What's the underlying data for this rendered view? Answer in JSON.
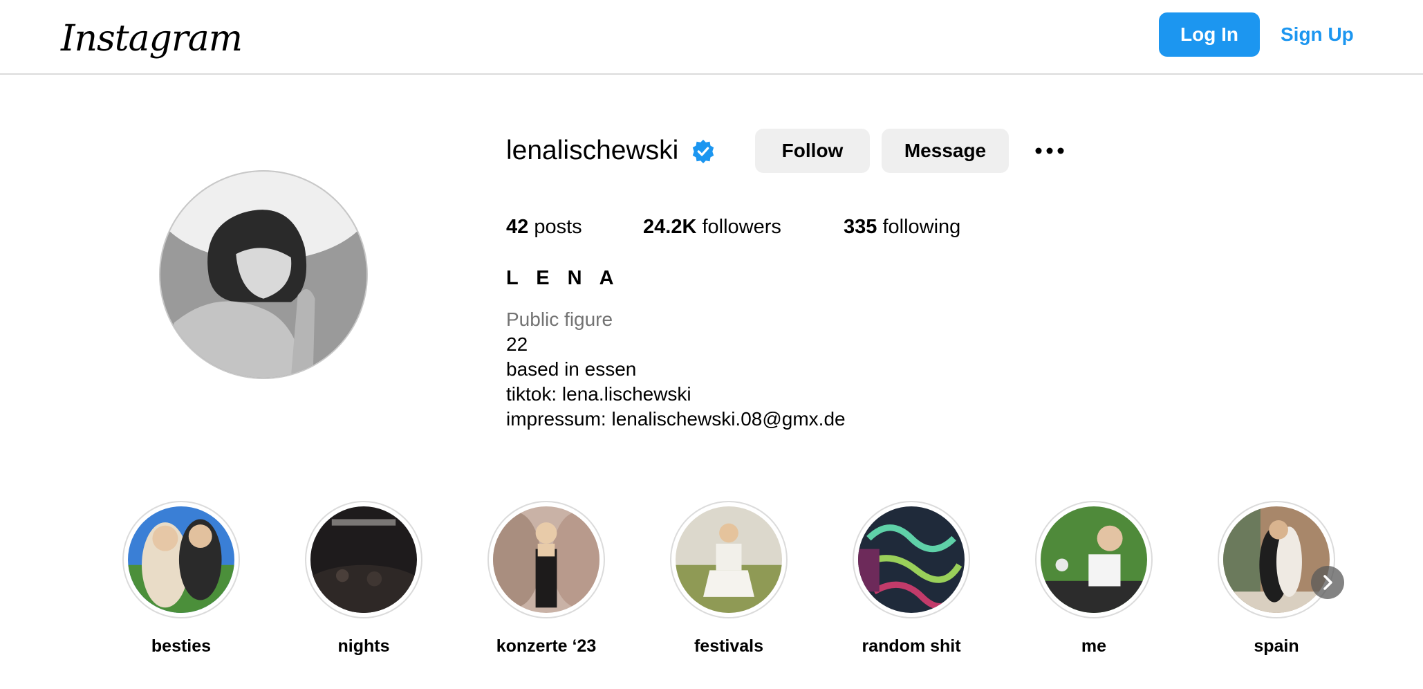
{
  "header": {
    "logo_text": "Instagram",
    "login_label": "Log In",
    "signup_label": "Sign Up",
    "accent_color": "#1c96f0"
  },
  "profile": {
    "username": "lenalischewski",
    "verified_icon": "verified-badge-icon",
    "follow_label": "Follow",
    "message_label": "Message",
    "more_icon": "more-options-icon",
    "posts_count": "42",
    "posts_label": "posts",
    "followers_count": "24.2K",
    "followers_label": "followers",
    "following_count": "335",
    "following_label": "following",
    "full_name": "L E N A",
    "category": "Public figure",
    "bio": [
      "22",
      "based in essen",
      "tiktok: lena.lischewski",
      "impressum: lenalischewski.08@gmx.de"
    ]
  },
  "highlights": [
    {
      "label": "besties"
    },
    {
      "label": "nights"
    },
    {
      "label": "konzerte ‘23"
    },
    {
      "label": "festivals"
    },
    {
      "label": "random shit"
    },
    {
      "label": "me"
    },
    {
      "label": "spain"
    }
  ],
  "highlights_next_icon": "chevron-right-icon"
}
